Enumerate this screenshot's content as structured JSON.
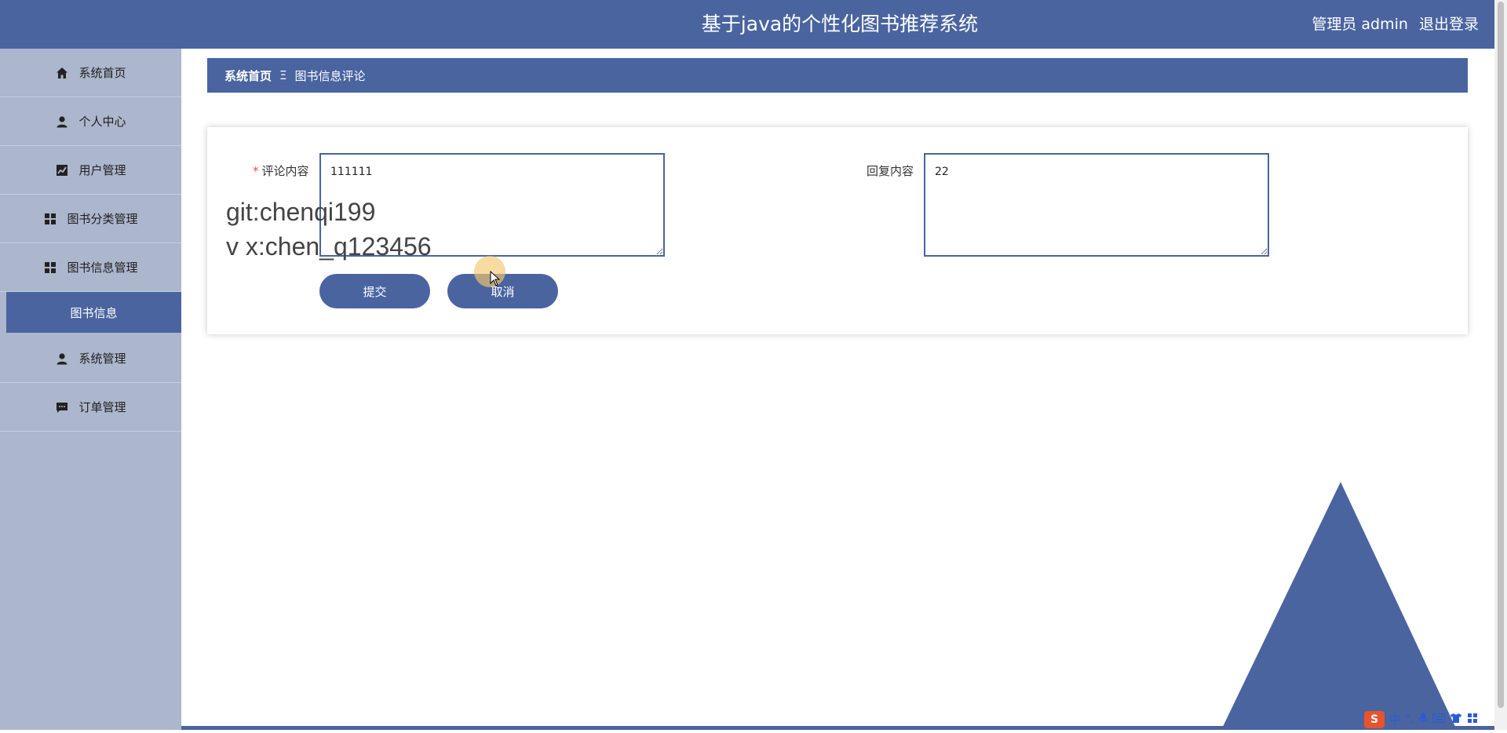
{
  "header": {
    "title": "基于java的个性化图书推荐系统",
    "role": "管理员 admin",
    "logout": "退出登录"
  },
  "sidebar": {
    "items": [
      {
        "label": "系统首页",
        "icon": "home-icon"
      },
      {
        "label": "个人中心",
        "icon": "person-icon"
      },
      {
        "label": "用户管理",
        "icon": "chart-icon"
      },
      {
        "label": "图书分类管理",
        "icon": "grid-icon"
      },
      {
        "label": "图书信息管理",
        "icon": "grid-icon"
      },
      {
        "label": "图书信息",
        "icon": "",
        "active": true
      },
      {
        "label": "系统管理",
        "icon": "person-icon"
      },
      {
        "label": "订单管理",
        "icon": "chat-icon"
      }
    ]
  },
  "breadcrumb": {
    "home": "系统首页",
    "separator": "Ξ",
    "current": "图书信息评论"
  },
  "form": {
    "comment_label": "评论内容",
    "required_mark": "*",
    "comment_value": "111111",
    "reply_label": "回复内容",
    "reply_value": "22",
    "submit_label": "提交",
    "cancel_label": "取消"
  },
  "watermark": {
    "line1": "git:chenqi199",
    "line2": "v x:chen_q123456"
  },
  "ime": {
    "logo": "S",
    "lang": "中",
    "punct": "°,"
  },
  "colors": {
    "primary": "#4a64a0",
    "sidebar_bg": "#acb6cc",
    "required": "#e05050"
  }
}
